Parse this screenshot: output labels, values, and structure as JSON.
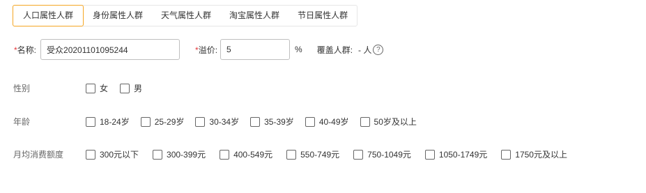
{
  "tabs": [
    {
      "label": "人口属性人群",
      "active": true
    },
    {
      "label": "身份属性人群",
      "active": false
    },
    {
      "label": "天气属性人群",
      "active": false
    },
    {
      "label": "淘宝属性人群",
      "active": false
    },
    {
      "label": "节日属性人群",
      "active": false
    }
  ],
  "form": {
    "required_mark": "*",
    "name_label": "名称:",
    "name_value": "受众20201101095244",
    "premium_label": "溢价:",
    "premium_value": "5",
    "premium_unit": "%",
    "coverage_label": "覆盖人群:",
    "coverage_value": "- 人",
    "help_glyph": "?"
  },
  "sections": {
    "gender": {
      "label": "性别",
      "options": [
        "女",
        "男"
      ]
    },
    "age": {
      "label": "年龄",
      "options": [
        "18-24岁",
        "25-29岁",
        "30-34岁",
        "35-39岁",
        "40-49岁",
        "50岁及以上"
      ]
    },
    "spending": {
      "label": "月均消费额度",
      "options": [
        "300元以下",
        "300-399元",
        "400-549元",
        "550-749元",
        "750-1049元",
        "1050-1749元",
        "1750元及以上"
      ]
    }
  },
  "colors": {
    "accent": "#f5a623",
    "required": "#e4393c"
  }
}
